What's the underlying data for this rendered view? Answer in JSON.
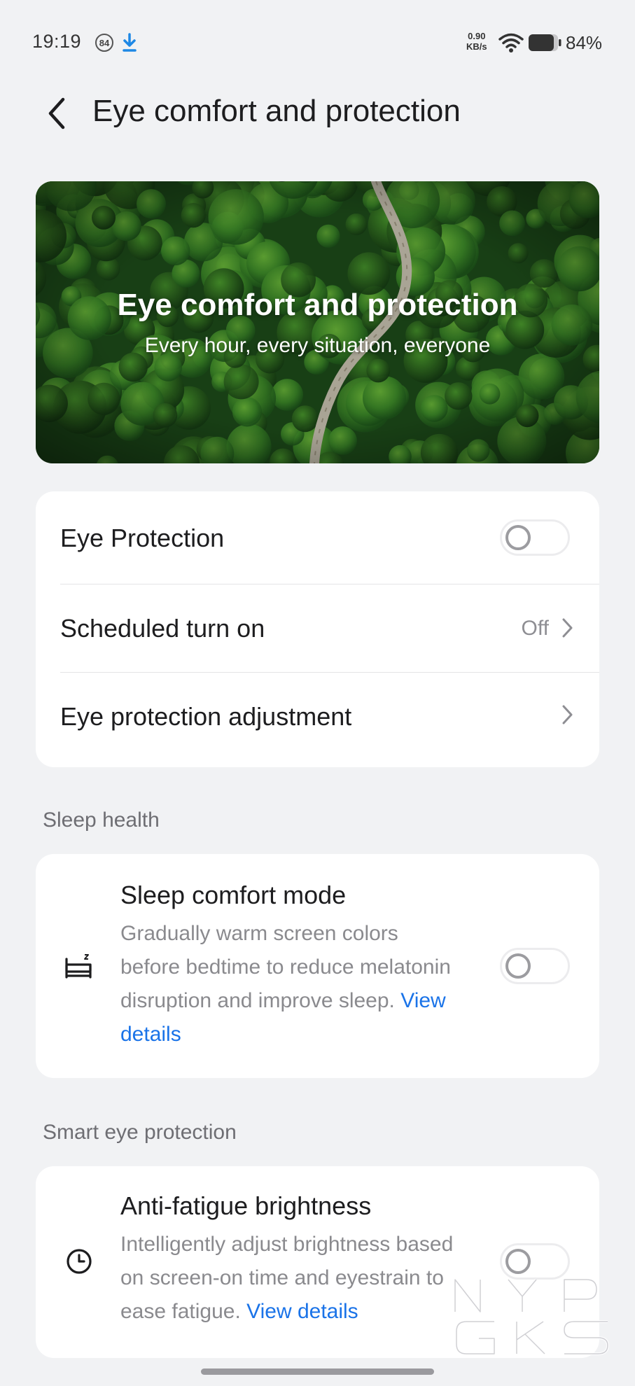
{
  "status_bar": {
    "time": "19:19",
    "notification_badge": "84",
    "net_speed_value": "0.90",
    "net_speed_unit": "KB/s",
    "battery_percent": "84%",
    "icons": [
      "download-icon",
      "wifi-icon",
      "battery-icon"
    ]
  },
  "header": {
    "title": "Eye comfort and protection",
    "back_icon": "chevron-left-icon"
  },
  "banner": {
    "title": "Eye comfort and protection",
    "subtitle": "Every hour, every situation, everyone"
  },
  "main_settings": {
    "eye_protection": {
      "label": "Eye Protection",
      "enabled": false
    },
    "scheduled": {
      "label": "Scheduled turn on",
      "value": "Off"
    },
    "adjustment": {
      "label": "Eye protection adjustment"
    }
  },
  "sleep_health": {
    "heading": "Sleep health",
    "sleep_comfort": {
      "title": "Sleep comfort mode",
      "desc_line1": "Gradually warm screen colors",
      "desc_line2": "before bedtime to reduce melatonin",
      "desc_line3": "disruption and improve sleep.",
      "link_part1": "View",
      "link_part2": "details",
      "enabled": false,
      "icon": "bed-icon"
    }
  },
  "smart_eye_protection": {
    "heading": "Smart eye protection",
    "anti_fatigue": {
      "title": "Anti-fatigue brightness",
      "desc_line1": "Intelligently adjust brightness based",
      "desc_line2": "on screen-on time and eyestrain to",
      "desc_line3": "ease fatigue.",
      "link": "View details",
      "enabled": false,
      "icon": "clock-icon"
    }
  },
  "colors": {
    "background": "#f1f2f4",
    "card": "#ffffff",
    "link": "#1a73e8",
    "secondary_text": "#8a8a8e"
  }
}
